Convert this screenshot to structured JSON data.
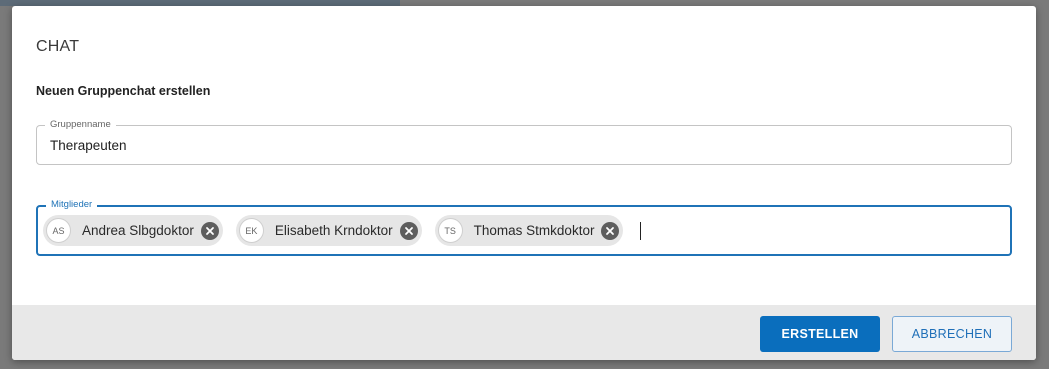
{
  "dialog": {
    "title": "CHAT",
    "subtitle": "Neuen Gruppenchat erstellen"
  },
  "group_name_field": {
    "label": "Gruppenname",
    "value": "Therapeuten"
  },
  "members_field": {
    "label": "Mitglieder",
    "members": [
      {
        "initials": "AS",
        "name": "Andrea Slbgdoktor"
      },
      {
        "initials": "EK",
        "name": "Elisabeth Krndoktor"
      },
      {
        "initials": "TS",
        "name": "Thomas Stmkdoktor"
      }
    ]
  },
  "footer": {
    "create_label": "ERSTELLEN",
    "cancel_label": "ABBRECHEN"
  },
  "colors": {
    "accent": "#0a6ebd",
    "focus_border": "#1f73b7",
    "chip_background": "#e6e6e6"
  }
}
